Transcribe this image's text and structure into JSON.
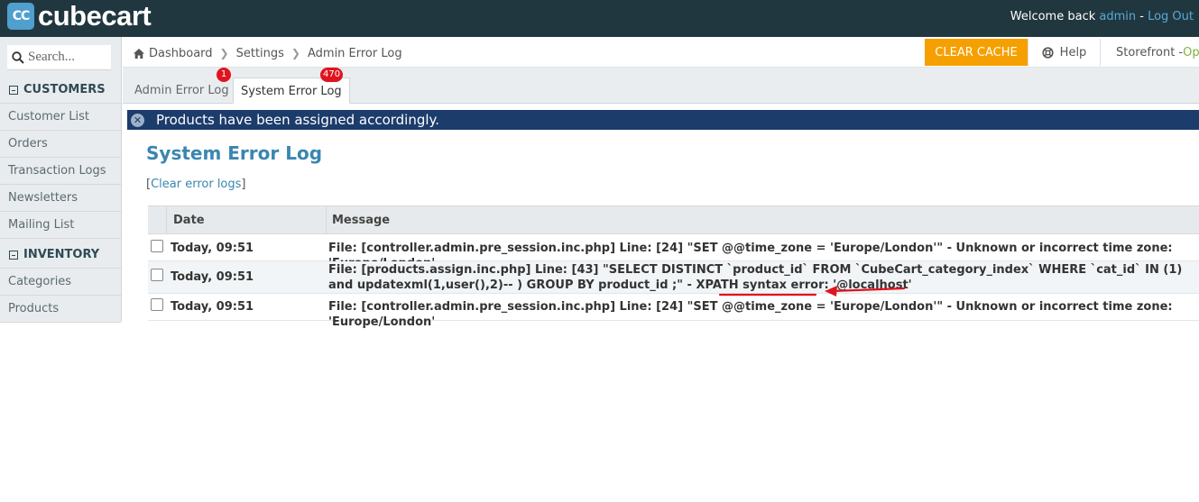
{
  "header": {
    "logo_badge": "CC",
    "logo_text": "cubecart",
    "welcome_prefix": "Welcome back ",
    "user": "admin",
    "separator": " - ",
    "logout": "Log Out"
  },
  "sidebar": {
    "search_placeholder": "Search...",
    "sections": [
      {
        "title": "CUSTOMERS",
        "items": [
          "Customer List",
          "Orders",
          "Transaction Logs",
          "Newsletters",
          "Mailing List"
        ]
      },
      {
        "title": "INVENTORY",
        "items": [
          "Categories",
          "Products"
        ]
      }
    ]
  },
  "breadcrumb": [
    "Dashboard",
    "Settings",
    "Admin Error Log"
  ],
  "toolbar": {
    "clear_cache": "CLEAR CACHE",
    "help": "Help",
    "storefront": "Storefront - ",
    "storefront_status": "Open"
  },
  "tabs": [
    {
      "label": "Admin Error Log",
      "badge": "1",
      "active": false
    },
    {
      "label": "System Error Log",
      "badge": "470",
      "active": true
    }
  ],
  "notice": "Products have been assigned accordingly.",
  "page": {
    "title": "System Error Log",
    "clear_link_open": "[",
    "clear_link": "Clear error logs",
    "clear_link_close": "]"
  },
  "table": {
    "columns": [
      "Date",
      "Message"
    ],
    "rows": [
      {
        "date": "Today, 09:51",
        "message": "File: [controller.admin.pre_session.inc.php] Line: [24] \"SET @@time_zone = 'Europe/London'\" - Unknown or incorrect time zone: 'Europe/London'"
      },
      {
        "date": "Today, 09:51",
        "message": "File: [products.assign.inc.php] Line: [43] \"SELECT DISTINCT `product_id` FROM `CubeCart_category_index` WHERE `cat_id` IN (1) and updatexml(1,user(),2)-- ) GROUP BY product_id ;\" - XPATH syntax error: '@localhost'"
      },
      {
        "date": "Today, 09:51",
        "message": "File: [controller.admin.pre_session.inc.php] Line: [24] \"SET @@time_zone = 'Europe/London'\" - Unknown or incorrect time zone: 'Europe/London'"
      }
    ]
  },
  "colors": {
    "header_bg": "#21373f",
    "accent_blue": "#3a86b0",
    "notice_bg": "#1c3c6b",
    "cache_button": "#f6a000",
    "badge_red": "#e0141e",
    "annotation_red": "#e0141e"
  }
}
